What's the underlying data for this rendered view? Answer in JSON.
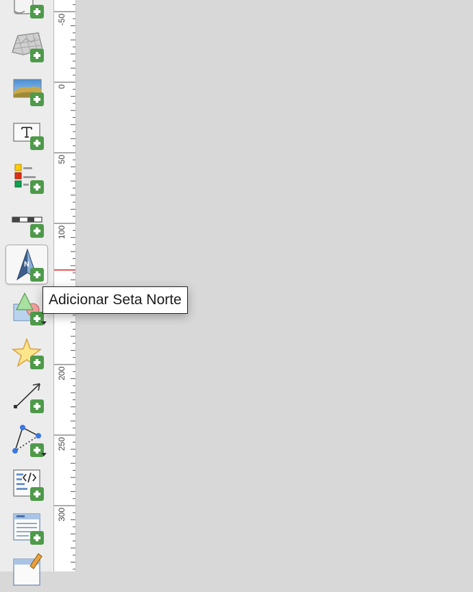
{
  "toolbar": {
    "tools": [
      {
        "name": "add-page",
        "icon": "page-add-icon"
      },
      {
        "name": "add-3d-map",
        "icon": "map-3d-add-icon"
      },
      {
        "name": "add-picture",
        "icon": "picture-add-icon"
      },
      {
        "name": "add-label",
        "icon": "label-add-icon"
      },
      {
        "name": "add-legend",
        "icon": "legend-add-icon"
      },
      {
        "name": "add-scale-bar",
        "icon": "scale-bar-add-icon"
      },
      {
        "name": "add-north-arrow",
        "icon": "north-arrow-add-icon",
        "active": true
      },
      {
        "name": "add-shape",
        "icon": "shape-add-icon"
      },
      {
        "name": "add-marker",
        "icon": "star-marker-add-icon"
      },
      {
        "name": "add-arrow",
        "icon": "arrow-add-icon"
      },
      {
        "name": "add-node-item",
        "icon": "polyline-add-icon"
      },
      {
        "name": "add-html",
        "icon": "html-add-icon"
      },
      {
        "name": "add-attribute-table",
        "icon": "attribute-table-add-icon"
      },
      {
        "name": "add-fixed-table",
        "icon": "fixed-table-add-icon"
      }
    ]
  },
  "ruler": {
    "labels": [
      "-50",
      "0",
      "50",
      "100",
      "200",
      "250",
      "300"
    ]
  },
  "tooltip": {
    "text": "Adicionar Seta Norte"
  },
  "colors": {
    "toolbar_bg": "#ececec",
    "canvas_bg": "#d8d8d8",
    "add_badge": "#4e9a4a",
    "cursor_marker": "#e02020"
  }
}
